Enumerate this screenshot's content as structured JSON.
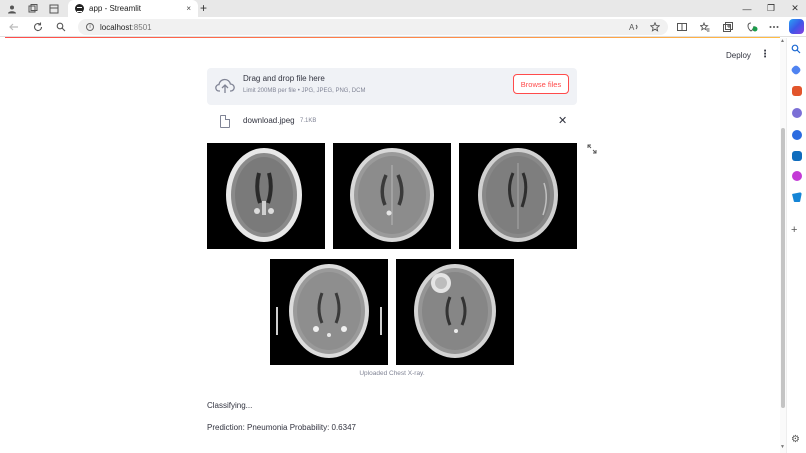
{
  "browser": {
    "tab_title": "app - Streamlit",
    "tab_close": "×",
    "new_tab": "+",
    "url_host": "localhost",
    "url_port": ":8501",
    "window_controls": [
      "—",
      "❐",
      "✕"
    ]
  },
  "header": {
    "deploy_label": "Deploy",
    "menu_icon": "⋮"
  },
  "uploader": {
    "title": "Drag and drop file here",
    "subtitle": "Limit 200MB per file • JPG, JPEG, PNG, DCM",
    "browse_label": "Browse files"
  },
  "file": {
    "name": "download.jpeg",
    "size": "7.1KB",
    "remove_icon": "✕"
  },
  "image": {
    "caption": "Uploaded Chest X-ray.",
    "scan_count": 5
  },
  "result": {
    "status": "Classifying...",
    "prediction": "Prediction: Pneumonia Probability: 0.6347"
  },
  "colors": {
    "accent": "#ff4b4b",
    "uploader_bg": "#f0f2f6",
    "text": "#31333f",
    "muted": "#808495"
  }
}
